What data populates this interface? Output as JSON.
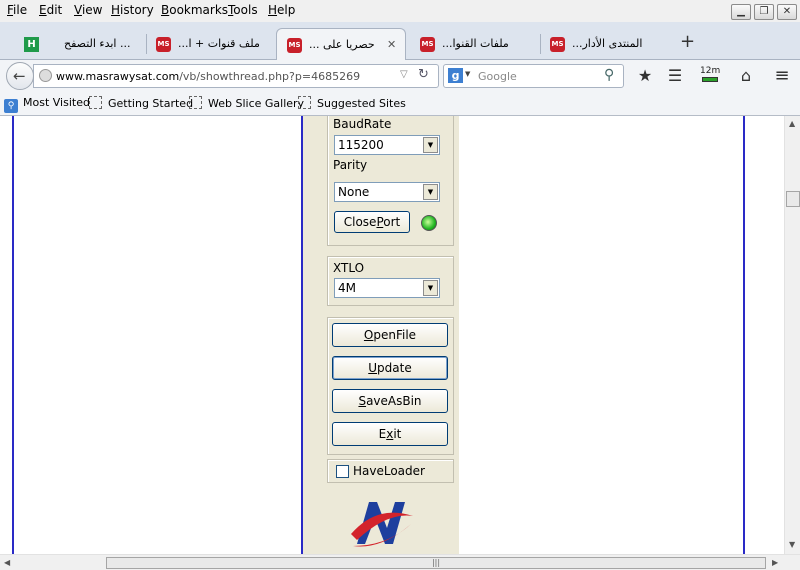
{
  "menu": {
    "items": [
      {
        "key": "F",
        "rest": "ile"
      },
      {
        "key": "E",
        "rest": "dit"
      },
      {
        "key": "V",
        "rest": "iew"
      },
      {
        "key": "H",
        "rest": "istory"
      },
      {
        "key": "B",
        "rest": "ookmarks"
      },
      {
        "key": "T",
        "rest": "ools"
      },
      {
        "key": "H",
        "rest": "elp"
      }
    ]
  },
  "tabs": [
    {
      "title": "... ابدء التصفح"
    },
    {
      "title": "ملف قنوات + ا..."
    },
    {
      "title": "حصريا على ..."
    },
    {
      "title": "ملفات القنوا..."
    },
    {
      "title": "المنتدى الأدار..."
    }
  ],
  "tab_close_glyph": "✕",
  "new_tab_glyph": "+",
  "navbar": {
    "url_domain": "www.masrawysat.com",
    "url_path": "/vb/showthread.php?p=4685269",
    "search_placeholder": "Google",
    "download_badge": "12m"
  },
  "bookmarks": [
    "Most Visited",
    "Getting Started",
    "Web Slice Gallery",
    "Suggested Sites"
  ],
  "app": {
    "baud_label": "BaudRate",
    "baud_value": "115200",
    "parity_label": "Parity",
    "parity_value": "None",
    "close_port": {
      "pre": "Close",
      "key": "P",
      "post": "ort"
    },
    "xtlo_label": "XTLO",
    "xtlo_value": "4M",
    "open_file": {
      "pre": "",
      "key": "O",
      "post": "penFile"
    },
    "update": {
      "pre": "",
      "key": "U",
      "post": "pdate"
    },
    "save_as_bin": {
      "pre": "",
      "key": "S",
      "post": "aveAsBin"
    },
    "exit": {
      "pre": "E",
      "key": "x",
      "post": "it"
    },
    "have_loader_label": "HaveLoader",
    "have_loader_checked": false
  },
  "scroll_grip": "|||",
  "colors": {
    "logo_red": "#d3232b",
    "logo_blue": "#1e3f9e",
    "frame_blue": "#2a2ac6",
    "panel_bg": "#ece9d8"
  }
}
